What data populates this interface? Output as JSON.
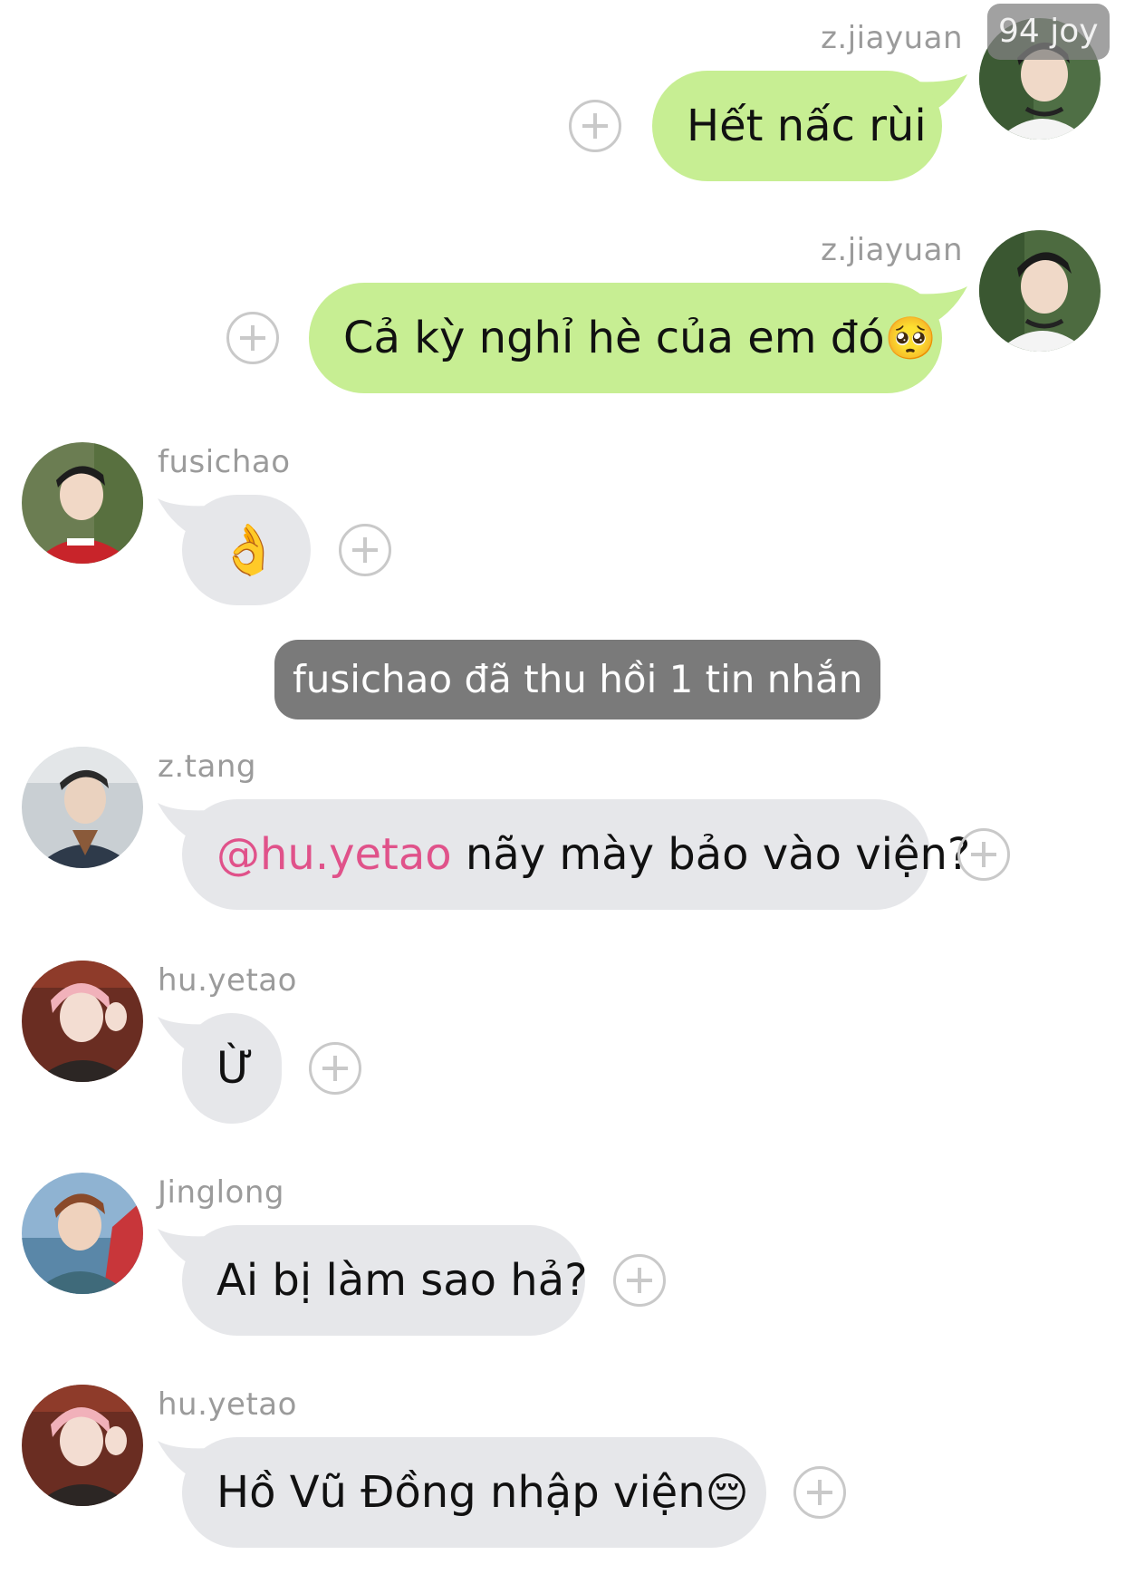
{
  "corner_badge": "94 joy",
  "system_notice": "fusichao đã thu hồi 1 tin nhắn",
  "messages": [
    {
      "sender": "z.jiayuan",
      "text": "Hết nấc rùi",
      "emoji": ""
    },
    {
      "sender": "z.jiayuan",
      "text": "Cả kỳ nghỉ hè của em đó",
      "emoji": "🥺"
    },
    {
      "sender": "fusichao",
      "text": "",
      "emoji": "👌"
    },
    {
      "sender": "z.tang",
      "mention": "@hu.yetao",
      "text": " nãy mày bảo vào viện?"
    },
    {
      "sender": "hu.yetao",
      "text": "Ừ"
    },
    {
      "sender": "Jinglong",
      "text": "Ai bị làm sao hả?"
    },
    {
      "sender": "hu.yetao",
      "text": "Hồ Vũ Đồng nhập viện",
      "emoji": "😔"
    }
  ],
  "colors": {
    "outgoing_bubble": "#c7ee93",
    "incoming_bubble": "#e6e7ea",
    "mention": "#e0528a",
    "system_pill": "#7a7a7a",
    "sender_name": "#9b9b9b"
  },
  "icons": {
    "reaction": "add-reaction-icon",
    "avatar": "user-avatar-photo"
  }
}
